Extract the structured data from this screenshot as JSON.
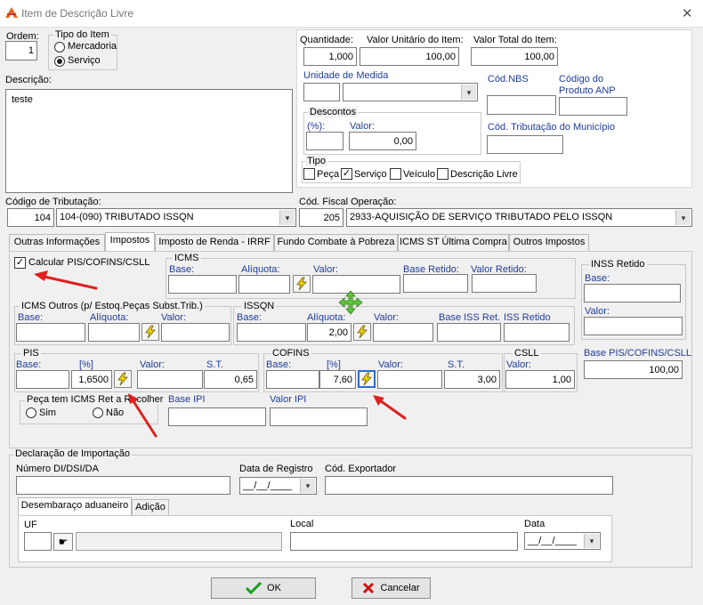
{
  "window": {
    "title": "Item de Descrição Livre",
    "close_glyph": "✕"
  },
  "ordem": {
    "label": "Ordem:",
    "value": "1"
  },
  "tipo_item": {
    "title": "Tipo do Item",
    "mercadoria": "Mercadoria",
    "servico": "Serviço",
    "selected": "servico"
  },
  "descricao": {
    "label": "Descrição:",
    "value": "teste"
  },
  "quantidade": {
    "label": "Quantidade:",
    "value": "1,000"
  },
  "valor_unitario": {
    "label": "Valor Unitário do Item:",
    "value": "100,00"
  },
  "valor_total": {
    "label": "Valor Total do Item:",
    "value": "100,00"
  },
  "unidade_medida": {
    "label": "Unidade de Medida",
    "code": "",
    "selected": ""
  },
  "cod_nbs": {
    "label": "Cód.NBS",
    "value": ""
  },
  "codigo_anp": {
    "label_line1": "Código do",
    "label_line2": "Produto ANP",
    "value": ""
  },
  "descontos": {
    "title": "Descontos",
    "pct_label": "(%):",
    "pct_value": "",
    "valor_label": "Valor:",
    "valor_value": "0,00"
  },
  "cod_trib_municipio": {
    "label": "Cód. Tributação do Município",
    "value": ""
  },
  "tipo": {
    "title": "Tipo",
    "options": [
      {
        "label": "Peça",
        "checked": false
      },
      {
        "label": "Serviço",
        "checked": true
      },
      {
        "label": "Veículo",
        "checked": false
      },
      {
        "label": "Descrição Livre",
        "checked": false
      }
    ]
  },
  "codigo_tributacao": {
    "label": "Código de Tributação:",
    "code": "104",
    "selected": "104-(090) TRIBUTADO ISSQN"
  },
  "cod_fiscal": {
    "label": "Cód. Fiscal Operação:",
    "code": "205",
    "selected": "2933-AQUISIÇÃO DE SERVIÇO TRIBUTADO PELO ISSQN"
  },
  "tabs": [
    "Outras Informações",
    "Impostos",
    "Imposto de Renda - IRRF",
    "Fundo Combate à Pobreza",
    "ICMS ST Última Compra",
    "Outros Impostos"
  ],
  "active_tab": "Impostos",
  "impostos": {
    "calcular_label": "Calcular PIS/COFINS/CSLL",
    "calcular_checked": true,
    "icms": {
      "title": "ICMS",
      "base": "Base:",
      "aliquota": "Alíquota:",
      "valor": "Valor:",
      "base_retido": "Base Retido:",
      "valor_retido": "Valor Retido:",
      "values": {
        "base": "",
        "aliquota": "",
        "valor": "",
        "base_retido": "",
        "valor_retido": ""
      }
    },
    "inss": {
      "title": "INSS Retido",
      "base": "Base:",
      "valor": "Valor:",
      "values": {
        "base": "",
        "valor": ""
      }
    },
    "icms_outros": {
      "title": "ICMS Outros (p/ Estoq.Peças Subst.Trib.)",
      "base": "Base:",
      "aliquota": "Alíquota:",
      "valor": "Valor:",
      "values": {
        "base": "",
        "aliquota": "",
        "valor": ""
      }
    },
    "issqn": {
      "title": "ISSQN",
      "base": "Base:",
      "aliquota": "Alíquota:",
      "valor": "Valor:",
      "base_iss_ret": "Base ISS Ret.",
      "iss_retido": "ISS Retido",
      "values": {
        "base": "",
        "aliquota": "2,00",
        "valor": "",
        "base_iss_ret": "",
        "iss_retido": ""
      }
    },
    "pis": {
      "title": "PIS",
      "base": "Base:",
      "pct": "[%]",
      "valor": "Valor:",
      "st": "S.T.",
      "values": {
        "base": "",
        "pct": "1,6500",
        "valor": "",
        "st": "0,65"
      }
    },
    "cofins": {
      "title": "COFINS",
      "base": "Base:",
      "pct": "[%]",
      "valor": "Valor:",
      "st": "S.T.",
      "values": {
        "base": "",
        "pct": "7,60",
        "valor": "",
        "st": "3,00"
      }
    },
    "csll": {
      "title": "CSLL",
      "valor": "Valor:",
      "values": {
        "valor": "1,00"
      }
    },
    "base_pis_cofins_csll": {
      "label": "Base PIS/COFINS/CSLL",
      "value": "100,00"
    },
    "peca_icms": {
      "title": "Peça tem ICMS Ret a Recolher",
      "sim": "Sim",
      "nao": "Não"
    },
    "base_ipi": {
      "label": "Base IPI",
      "value": ""
    },
    "valor_ipi": {
      "label": "Valor IPI",
      "value": ""
    }
  },
  "declaracao": {
    "title": "Declaração de Importação",
    "numero_label": "Número DI/DSI/DA",
    "numero_value": "",
    "data_registro_label": "Data de Registro",
    "data_registro_value": "__/__/____",
    "cod_exportador_label": "Cód. Exportador",
    "cod_exportador_value": "",
    "subtabs": [
      "Desembaraço aduaneiro",
      "Adição"
    ],
    "uf_label": "UF",
    "uf_value": "",
    "local_label": "Local",
    "local_value": "",
    "data_label": "Data",
    "data_value": "__/__/____"
  },
  "buttons": {
    "ok": "OK",
    "cancelar": "Cancelar"
  },
  "colors": {
    "accent_red": "#e02020",
    "label_blue": "#1f3d99",
    "ok_green": "#1aa01a",
    "cancel_red": "#d01010",
    "move_cursor_green": "#5cc43a"
  }
}
